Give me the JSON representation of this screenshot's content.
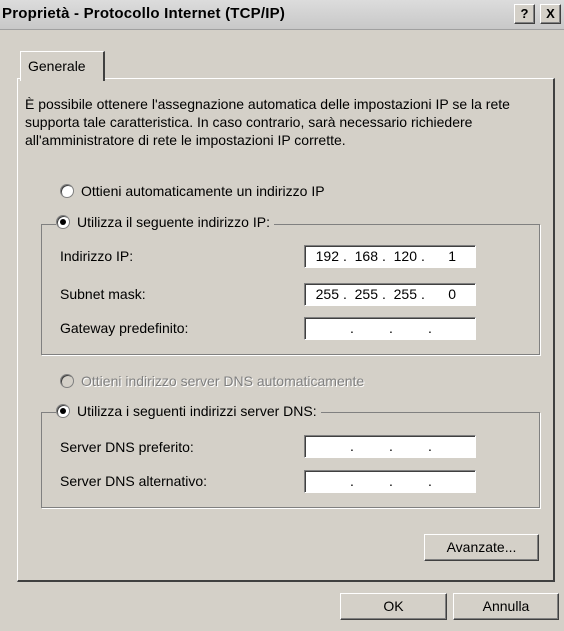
{
  "window": {
    "title": "Proprietà - Protocollo Internet (TCP/IP)",
    "help_label": "?",
    "close_label": "X"
  },
  "tabs": [
    {
      "label": "Generale"
    }
  ],
  "description": "È possibile ottenere l'assegnazione automatica delle impostazioni IP se la rete supporta tale caratteristica. In caso contrario, sarà necessario richiedere all'amministratore di rete le impostazioni IP corrette.",
  "ip_section": {
    "auto_label": "Ottieni automaticamente un indirizzo IP",
    "manual_label": "Utilizza il seguente indirizzo IP:",
    "selected": "manual",
    "fields": [
      {
        "label": "Indirizzo IP:",
        "octets": [
          "192",
          "168",
          "120",
          "1"
        ]
      },
      {
        "label": "Subnet mask:",
        "octets": [
          "255",
          "255",
          "255",
          "0"
        ]
      },
      {
        "label": "Gateway predefinito:",
        "octets": [
          "",
          "",
          "",
          ""
        ]
      }
    ]
  },
  "dns_section": {
    "auto_label": "Ottieni indirizzo server DNS automaticamente",
    "auto_enabled": false,
    "manual_label": "Utilizza i seguenti indirizzi server DNS:",
    "selected": "manual",
    "fields": [
      {
        "label": "Server DNS preferito:",
        "octets": [
          "",
          "",
          "",
          ""
        ]
      },
      {
        "label": "Server DNS alternativo:",
        "octets": [
          "",
          "",
          "",
          ""
        ]
      }
    ]
  },
  "buttons": {
    "advanced": "Avanzate...",
    "ok": "OK",
    "cancel": "Annulla"
  }
}
